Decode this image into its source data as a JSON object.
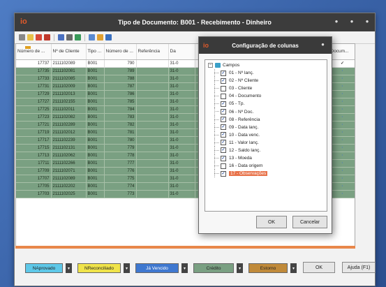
{
  "window": {
    "title": "Tipo de Documento: B001 - Recebimento - Dinheiro",
    "app_logo": "io"
  },
  "icons": [
    "filter-icon",
    "new-icon",
    "edit-icon",
    "delete-icon",
    "print-icon",
    "export-icon",
    "refresh-icon",
    "columns-icon",
    "tools-icon",
    "help-icon"
  ],
  "grid": {
    "columns": [
      "Número de ...",
      "Nº de Cliente",
      "Tipo ...",
      "Número de ...",
      "Referência",
      "Da",
      "",
      "",
      "",
      "Ob...",
      "Docum..."
    ],
    "first_row": [
      "17737",
      "2111102089",
      "B001",
      "790",
      "",
      "31-0",
      "",
      "",
      "",
      "Pa...",
      "✓"
    ],
    "rows": [
      [
        "17735",
        "2111102081",
        "B001",
        "789",
        "",
        "31-0"
      ],
      [
        "17733",
        "2111102085",
        "B001",
        "788",
        "",
        "31-0"
      ],
      [
        "17731",
        "2111102009",
        "B001",
        "787",
        "",
        "31-0"
      ],
      [
        "17729",
        "2111102013",
        "B001",
        "786",
        "",
        "31-0"
      ],
      [
        "17727",
        "2111102155",
        "B001",
        "785",
        "",
        "31-0"
      ],
      [
        "17725",
        "2111102011",
        "B001",
        "784",
        "",
        "31-0"
      ],
      [
        "17723",
        "2111102082",
        "B001",
        "783",
        "",
        "31-0"
      ],
      [
        "17721",
        "2111102289",
        "B001",
        "782",
        "",
        "31-0"
      ],
      [
        "17719",
        "2111102012",
        "B001",
        "781",
        "",
        "31-0"
      ],
      [
        "17717",
        "2111102239",
        "B001",
        "780",
        "",
        "31-0"
      ],
      [
        "17715",
        "2111102131",
        "B001",
        "779",
        "",
        "31-0"
      ],
      [
        "17713",
        "2111102062",
        "B001",
        "778",
        "",
        "31-0"
      ],
      [
        "17711",
        "2111102266",
        "B001",
        "777",
        "",
        "31-0"
      ],
      [
        "17709",
        "2111102071",
        "B001",
        "776",
        "",
        "31-0"
      ],
      [
        "17707",
        "2111102089",
        "B001",
        "775",
        "",
        "31-0"
      ],
      [
        "17705",
        "2111102202",
        "B001",
        "774",
        "",
        "31-0"
      ],
      [
        "17703",
        "2111102025",
        "B001",
        "773",
        "",
        "31-0"
      ]
    ]
  },
  "legend": [
    {
      "label": "NAprovado",
      "color": "#5ec8e8"
    },
    {
      "label": "NReconciliado",
      "color": "#f0e44a"
    },
    {
      "label": "Já Vencido",
      "color": "#3f78d0"
    },
    {
      "label": "Crédito",
      "color": "#7aa082"
    },
    {
      "label": "Estorno",
      "color": "#c08a3a"
    }
  ],
  "buttons": {
    "ok": "OK",
    "help": "Ajuda (F1)"
  },
  "dialog": {
    "title": "Configuração de colunas",
    "root": "Campos",
    "items": [
      {
        "label": "01 - Nº lanç.",
        "checked": true
      },
      {
        "label": "02 - Nº Cliente",
        "checked": true
      },
      {
        "label": "03 - Cliente",
        "checked": false
      },
      {
        "label": "04 - Documento",
        "checked": false
      },
      {
        "label": "05 - Tp.",
        "checked": true
      },
      {
        "label": "06 - Nº Doc.",
        "checked": true
      },
      {
        "label": "08 - Referência",
        "checked": true
      },
      {
        "label": "09 - Data lanç.",
        "checked": true
      },
      {
        "label": "10 - Data venc.",
        "checked": true
      },
      {
        "label": "11 - Valor lanç.",
        "checked": true
      },
      {
        "label": "12 - Saldo lanç.",
        "checked": true
      },
      {
        "label": "13 - Moeda",
        "checked": true
      },
      {
        "label": "16 - Data origem",
        "checked": false
      },
      {
        "label": "17 - Observações",
        "checked": true,
        "selected": true
      }
    ],
    "ok": "OK",
    "cancel": "Cancelar"
  },
  "colors": {
    "row_green": "#7aa082",
    "accent_orange": "#e8734a",
    "check_blue": "#3a6fd0"
  }
}
